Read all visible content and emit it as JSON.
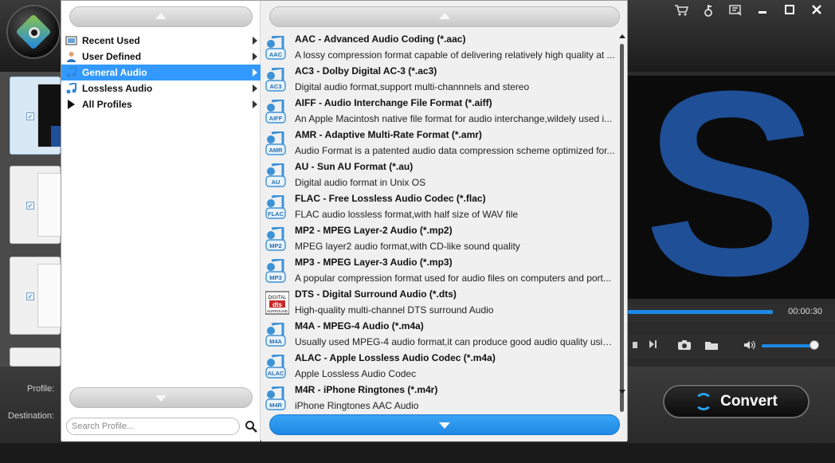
{
  "app": {
    "toolbar_icons": [
      "cart-icon",
      "key-icon",
      "feedback-icon",
      "minimize-icon",
      "maximize-icon",
      "close-icon"
    ]
  },
  "bottom": {
    "profile_label": "Profile:",
    "destination_label": "Destination:",
    "convert_label": "Convert"
  },
  "player": {
    "time": "00:00:30",
    "progress": 0.7,
    "volume": 0.9
  },
  "profile_panel": {
    "categories": [
      {
        "label": "Recent Used",
        "icon": "recent-icon",
        "selected": false
      },
      {
        "label": "User Defined",
        "icon": "user-icon",
        "selected": false
      },
      {
        "label": "General Audio",
        "icon": "music-note-icon",
        "selected": true
      },
      {
        "label": "Lossless Audio",
        "icon": "music-note-icon",
        "selected": false
      },
      {
        "label": "All Profiles",
        "icon": "play-triangle-icon",
        "selected": false
      }
    ],
    "search_placeholder": "Search Profile...",
    "formats": [
      {
        "icon_text": "AAC",
        "name": "AAC - Advanced Audio Coding (*.aac)",
        "desc": "A lossy compression format capable of delivering relatively high quality at ..."
      },
      {
        "icon_text": "AC3",
        "name": "AC3 - Dolby Digital AC-3 (*.ac3)",
        "desc": "Digital audio format,support multi-channnels and stereo"
      },
      {
        "icon_text": "AIFF",
        "name": "AIFF - Audio Interchange File Format (*.aiff)",
        "desc": "An Apple Macintosh native file format for audio interchange,wildely used i..."
      },
      {
        "icon_text": "AMR",
        "name": "AMR - Adaptive Multi-Rate Format (*.amr)",
        "desc": "Audio Format is a patented audio data compression scheme optimized for..."
      },
      {
        "icon_text": "AU",
        "name": "AU - Sun AU Format (*.au)",
        "desc": "Digital audio format in Unix OS"
      },
      {
        "icon_text": "FLAC",
        "name": "FLAC - Free Lossless Audio Codec (*.flac)",
        "desc": "FLAC audio lossless format,with half size of WAV file"
      },
      {
        "icon_text": "MP2",
        "name": "MP2 - MPEG Layer-2 Audio (*.mp2)",
        "desc": "MPEG layer2 audio format,with CD-like sound quality"
      },
      {
        "icon_text": "MP3",
        "name": "MP3 - MPEG Layer-3 Audio (*.mp3)",
        "desc": "A popular compression format used for audio files on computers and port..."
      },
      {
        "icon_text": "dts",
        "name": "DTS - Digital Surround Audio (*.dts)",
        "desc": "High-quality multi-channel DTS surround Audio"
      },
      {
        "icon_text": "M4A",
        "name": "M4A - MPEG-4 Audio (*.m4a)",
        "desc": "Usually used MPEG-4 audio format,it can produce good audio quality usin..."
      },
      {
        "icon_text": "ALAC",
        "name": "ALAC - Apple Lossless Audio Codec (*.m4a)",
        "desc": "Apple Lossless Audio Codec"
      },
      {
        "icon_text": "M4R",
        "name": "M4R - iPhone Ringtones (*.m4r)",
        "desc": "iPhone Ringtones AAC Audio"
      }
    ]
  }
}
